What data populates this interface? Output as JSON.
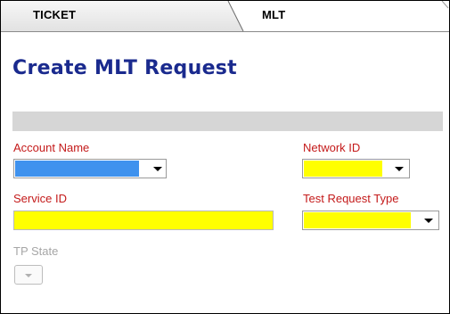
{
  "tabs": {
    "ticket_label": "TICKET",
    "mlt_label": "MLT"
  },
  "page": {
    "title": "Create MLT Request"
  },
  "form": {
    "account_name": {
      "label": "Account Name",
      "fill_color": "#3f92ee"
    },
    "network_id": {
      "label": "Network ID",
      "fill_color": "#ffff00"
    },
    "service_id": {
      "label": "Service ID",
      "fill_color": "#ffff00"
    },
    "test_request_type": {
      "label": "Test Request Type",
      "fill_color": "#ffff00"
    },
    "tp_state": {
      "label": "TP State",
      "disabled": true
    }
  },
  "colors": {
    "title": "#1a2a8e",
    "label_required": "#c41a1a",
    "label_disabled": "#a6a6a6",
    "section_bar": "#d6d6d6"
  }
}
